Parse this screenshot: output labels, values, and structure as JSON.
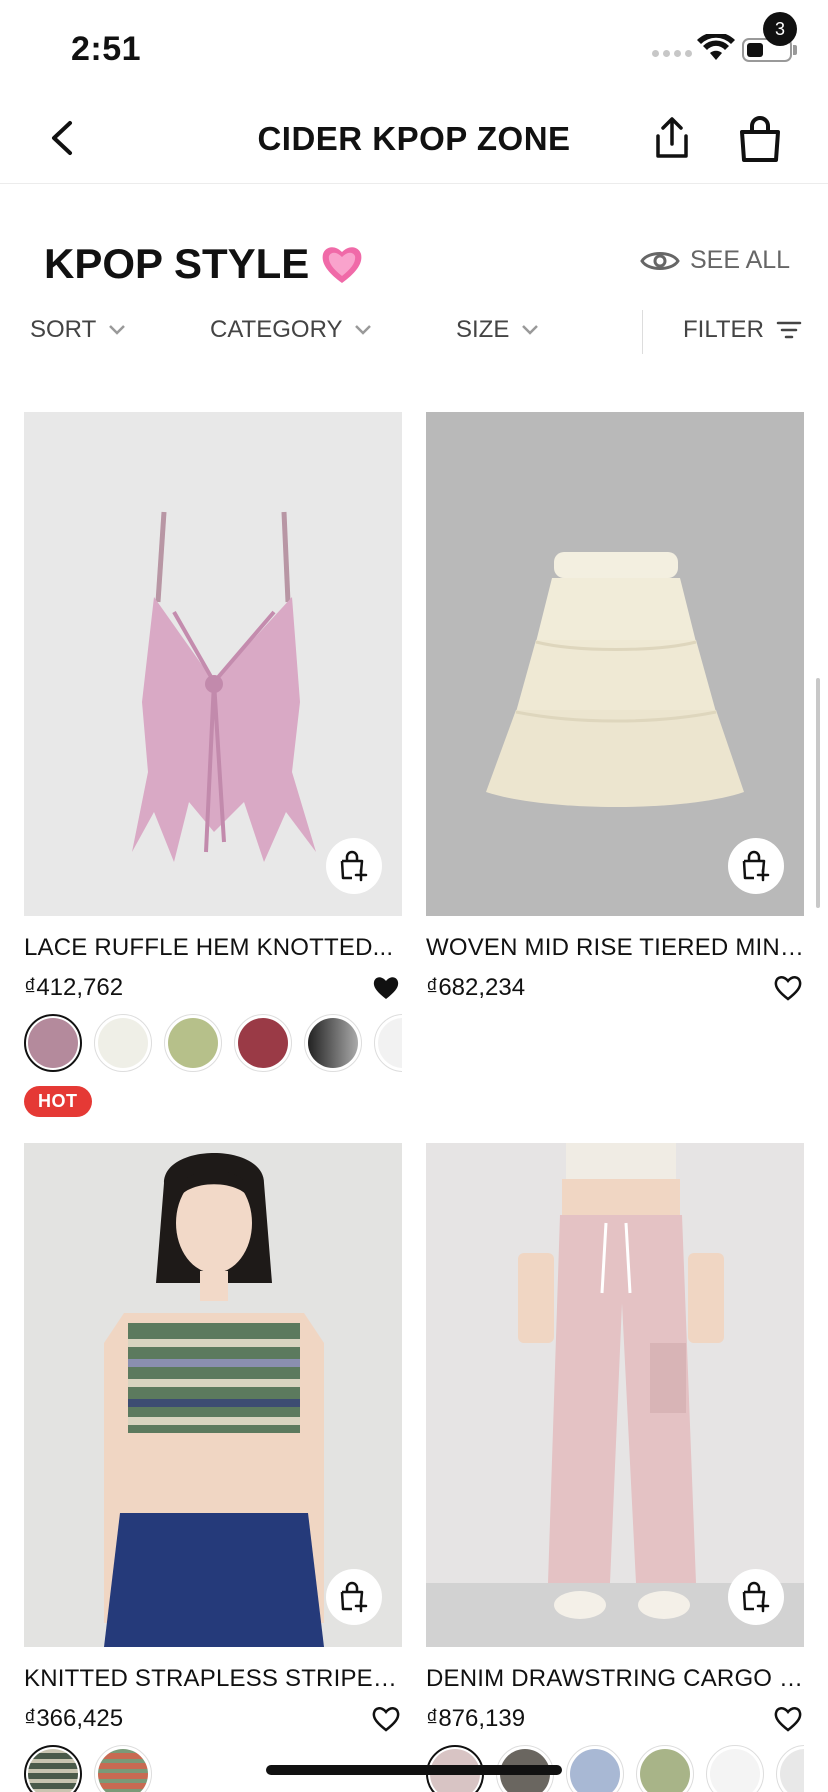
{
  "status_bar": {
    "time": "2:51"
  },
  "nav": {
    "title": "CIDER KPOP ZONE",
    "cart_count": "3"
  },
  "section": {
    "title": "KPOP STYLE",
    "see_all": "SEE ALL"
  },
  "filters": {
    "sort": "SORT",
    "category": "CATEGORY",
    "size": "SIZE",
    "filter": "FILTER"
  },
  "products": [
    {
      "name": "LACE RUFFLE HEM KNOTTED...",
      "price": "₫412,762",
      "wishlisted": true,
      "badge": "HOT",
      "swatches": [
        "#b48a9c",
        "#efefe7",
        "#b6c08a",
        "#9a3a46",
        "#3c3c3c",
        "#f2f2f2"
      ]
    },
    {
      "name": "WOVEN MID RISE TIERED MINI...",
      "price": "₫682,234",
      "wishlisted": false,
      "swatches": []
    },
    {
      "name": "KNITTED STRAPLESS STRIPED...",
      "price": "₫366,425",
      "wishlisted": false,
      "swatches": [
        "#4a5a4a",
        "#c86a52"
      ]
    },
    {
      "name": "DENIM DRAWSTRING CARGO P...",
      "price": "₫876,139",
      "wishlisted": false,
      "swatches": [
        "#d8c4c4",
        "#6a6660",
        "#a8b8d4",
        "#a8b488",
        "#f4f4f4",
        "#e8e8e8"
      ]
    }
  ],
  "colors": {
    "accent": "#111111",
    "hot": "#e53935",
    "price": "#111111"
  }
}
